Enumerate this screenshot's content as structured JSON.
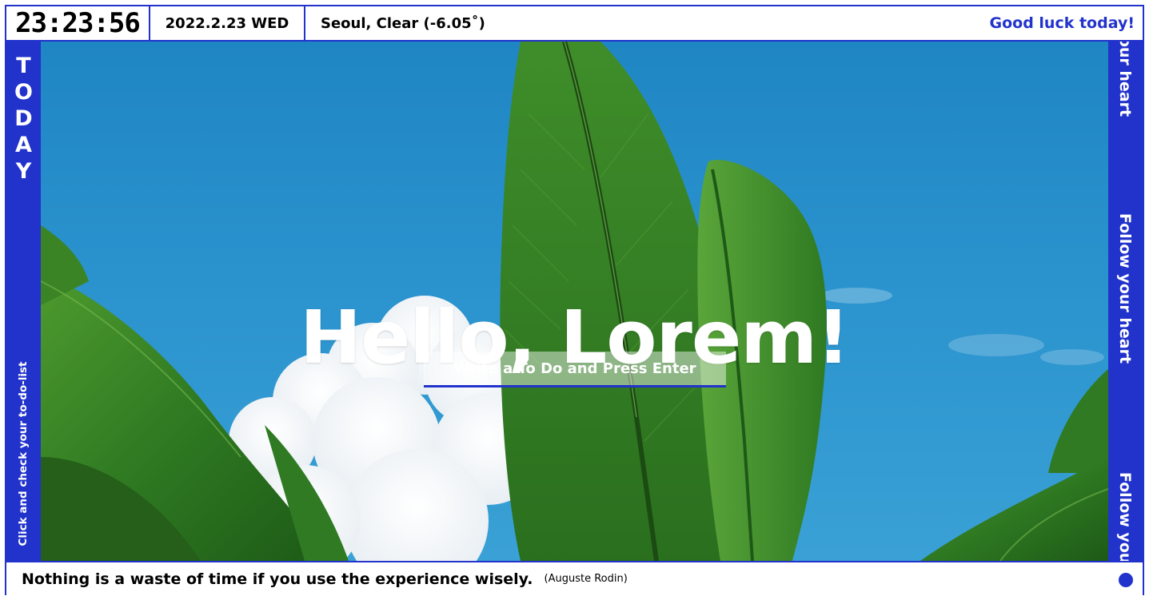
{
  "topbar": {
    "clock": "23:23:56",
    "date": "2022.2.23 WED",
    "weather": "Seoul, Clear (-6.05˚)",
    "message": "Good luck today!"
  },
  "left_sidebar": {
    "title": "TODAY",
    "title_letters": [
      "T",
      "O",
      "D",
      "A",
      "Y"
    ],
    "todo_link": "Click and check your to-do-list"
  },
  "right_sidebar": {
    "marquee_text": "Follow your heart"
  },
  "main": {
    "greeting": "Hello, Lorem!",
    "todo_placeholder": "Write a To Do and Press Enter",
    "background_image": "banana-leaves-sky"
  },
  "bottombar": {
    "quote": "Nothing is a waste of time if you use the experience wisely.",
    "author": "(Auguste Rodin)"
  },
  "colors": {
    "accent": "#2233cc",
    "sky": "#1f86c4",
    "leaf": "#3f8a2a"
  }
}
